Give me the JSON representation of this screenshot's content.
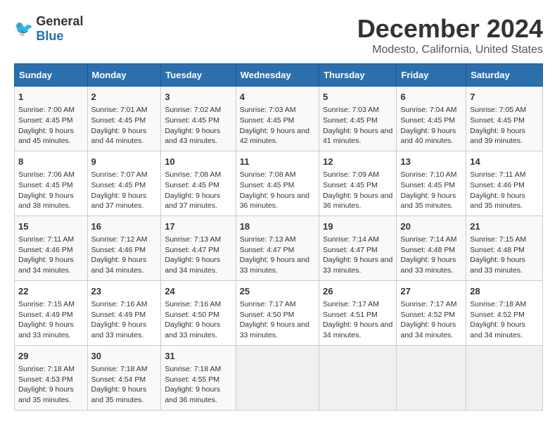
{
  "logo": {
    "general": "General",
    "blue": "Blue"
  },
  "title": "December 2024",
  "subtitle": "Modesto, California, United States",
  "days_of_week": [
    "Sunday",
    "Monday",
    "Tuesday",
    "Wednesday",
    "Thursday",
    "Friday",
    "Saturday"
  ],
  "weeks": [
    [
      {
        "day": "1",
        "sunrise": "Sunrise: 7:00 AM",
        "sunset": "Sunset: 4:45 PM",
        "daylight": "Daylight: 9 hours and 45 minutes."
      },
      {
        "day": "2",
        "sunrise": "Sunrise: 7:01 AM",
        "sunset": "Sunset: 4:45 PM",
        "daylight": "Daylight: 9 hours and 44 minutes."
      },
      {
        "day": "3",
        "sunrise": "Sunrise: 7:02 AM",
        "sunset": "Sunset: 4:45 PM",
        "daylight": "Daylight: 9 hours and 43 minutes."
      },
      {
        "day": "4",
        "sunrise": "Sunrise: 7:03 AM",
        "sunset": "Sunset: 4:45 PM",
        "daylight": "Daylight: 9 hours and 42 minutes."
      },
      {
        "day": "5",
        "sunrise": "Sunrise: 7:03 AM",
        "sunset": "Sunset: 4:45 PM",
        "daylight": "Daylight: 9 hours and 41 minutes."
      },
      {
        "day": "6",
        "sunrise": "Sunrise: 7:04 AM",
        "sunset": "Sunset: 4:45 PM",
        "daylight": "Daylight: 9 hours and 40 minutes."
      },
      {
        "day": "7",
        "sunrise": "Sunrise: 7:05 AM",
        "sunset": "Sunset: 4:45 PM",
        "daylight": "Daylight: 9 hours and 39 minutes."
      }
    ],
    [
      {
        "day": "8",
        "sunrise": "Sunrise: 7:06 AM",
        "sunset": "Sunset: 4:45 PM",
        "daylight": "Daylight: 9 hours and 38 minutes."
      },
      {
        "day": "9",
        "sunrise": "Sunrise: 7:07 AM",
        "sunset": "Sunset: 4:45 PM",
        "daylight": "Daylight: 9 hours and 37 minutes."
      },
      {
        "day": "10",
        "sunrise": "Sunrise: 7:08 AM",
        "sunset": "Sunset: 4:45 PM",
        "daylight": "Daylight: 9 hours and 37 minutes."
      },
      {
        "day": "11",
        "sunrise": "Sunrise: 7:08 AM",
        "sunset": "Sunset: 4:45 PM",
        "daylight": "Daylight: 9 hours and 36 minutes."
      },
      {
        "day": "12",
        "sunrise": "Sunrise: 7:09 AM",
        "sunset": "Sunset: 4:45 PM",
        "daylight": "Daylight: 9 hours and 36 minutes."
      },
      {
        "day": "13",
        "sunrise": "Sunrise: 7:10 AM",
        "sunset": "Sunset: 4:45 PM",
        "daylight": "Daylight: 9 hours and 35 minutes."
      },
      {
        "day": "14",
        "sunrise": "Sunrise: 7:11 AM",
        "sunset": "Sunset: 4:46 PM",
        "daylight": "Daylight: 9 hours and 35 minutes."
      }
    ],
    [
      {
        "day": "15",
        "sunrise": "Sunrise: 7:11 AM",
        "sunset": "Sunset: 4:46 PM",
        "daylight": "Daylight: 9 hours and 34 minutes."
      },
      {
        "day": "16",
        "sunrise": "Sunrise: 7:12 AM",
        "sunset": "Sunset: 4:46 PM",
        "daylight": "Daylight: 9 hours and 34 minutes."
      },
      {
        "day": "17",
        "sunrise": "Sunrise: 7:13 AM",
        "sunset": "Sunset: 4:47 PM",
        "daylight": "Daylight: 9 hours and 34 minutes."
      },
      {
        "day": "18",
        "sunrise": "Sunrise: 7:13 AM",
        "sunset": "Sunset: 4:47 PM",
        "daylight": "Daylight: 9 hours and 33 minutes."
      },
      {
        "day": "19",
        "sunrise": "Sunrise: 7:14 AM",
        "sunset": "Sunset: 4:47 PM",
        "daylight": "Daylight: 9 hours and 33 minutes."
      },
      {
        "day": "20",
        "sunrise": "Sunrise: 7:14 AM",
        "sunset": "Sunset: 4:48 PM",
        "daylight": "Daylight: 9 hours and 33 minutes."
      },
      {
        "day": "21",
        "sunrise": "Sunrise: 7:15 AM",
        "sunset": "Sunset: 4:48 PM",
        "daylight": "Daylight: 9 hours and 33 minutes."
      }
    ],
    [
      {
        "day": "22",
        "sunrise": "Sunrise: 7:15 AM",
        "sunset": "Sunset: 4:49 PM",
        "daylight": "Daylight: 9 hours and 33 minutes."
      },
      {
        "day": "23",
        "sunrise": "Sunrise: 7:16 AM",
        "sunset": "Sunset: 4:49 PM",
        "daylight": "Daylight: 9 hours and 33 minutes."
      },
      {
        "day": "24",
        "sunrise": "Sunrise: 7:16 AM",
        "sunset": "Sunset: 4:50 PM",
        "daylight": "Daylight: 9 hours and 33 minutes."
      },
      {
        "day": "25",
        "sunrise": "Sunrise: 7:17 AM",
        "sunset": "Sunset: 4:50 PM",
        "daylight": "Daylight: 9 hours and 33 minutes."
      },
      {
        "day": "26",
        "sunrise": "Sunrise: 7:17 AM",
        "sunset": "Sunset: 4:51 PM",
        "daylight": "Daylight: 9 hours and 34 minutes."
      },
      {
        "day": "27",
        "sunrise": "Sunrise: 7:17 AM",
        "sunset": "Sunset: 4:52 PM",
        "daylight": "Daylight: 9 hours and 34 minutes."
      },
      {
        "day": "28",
        "sunrise": "Sunrise: 7:18 AM",
        "sunset": "Sunset: 4:52 PM",
        "daylight": "Daylight: 9 hours and 34 minutes."
      }
    ],
    [
      {
        "day": "29",
        "sunrise": "Sunrise: 7:18 AM",
        "sunset": "Sunset: 4:53 PM",
        "daylight": "Daylight: 9 hours and 35 minutes."
      },
      {
        "day": "30",
        "sunrise": "Sunrise: 7:18 AM",
        "sunset": "Sunset: 4:54 PM",
        "daylight": "Daylight: 9 hours and 35 minutes."
      },
      {
        "day": "31",
        "sunrise": "Sunrise: 7:18 AM",
        "sunset": "Sunset: 4:55 PM",
        "daylight": "Daylight: 9 hours and 36 minutes."
      },
      null,
      null,
      null,
      null
    ]
  ]
}
